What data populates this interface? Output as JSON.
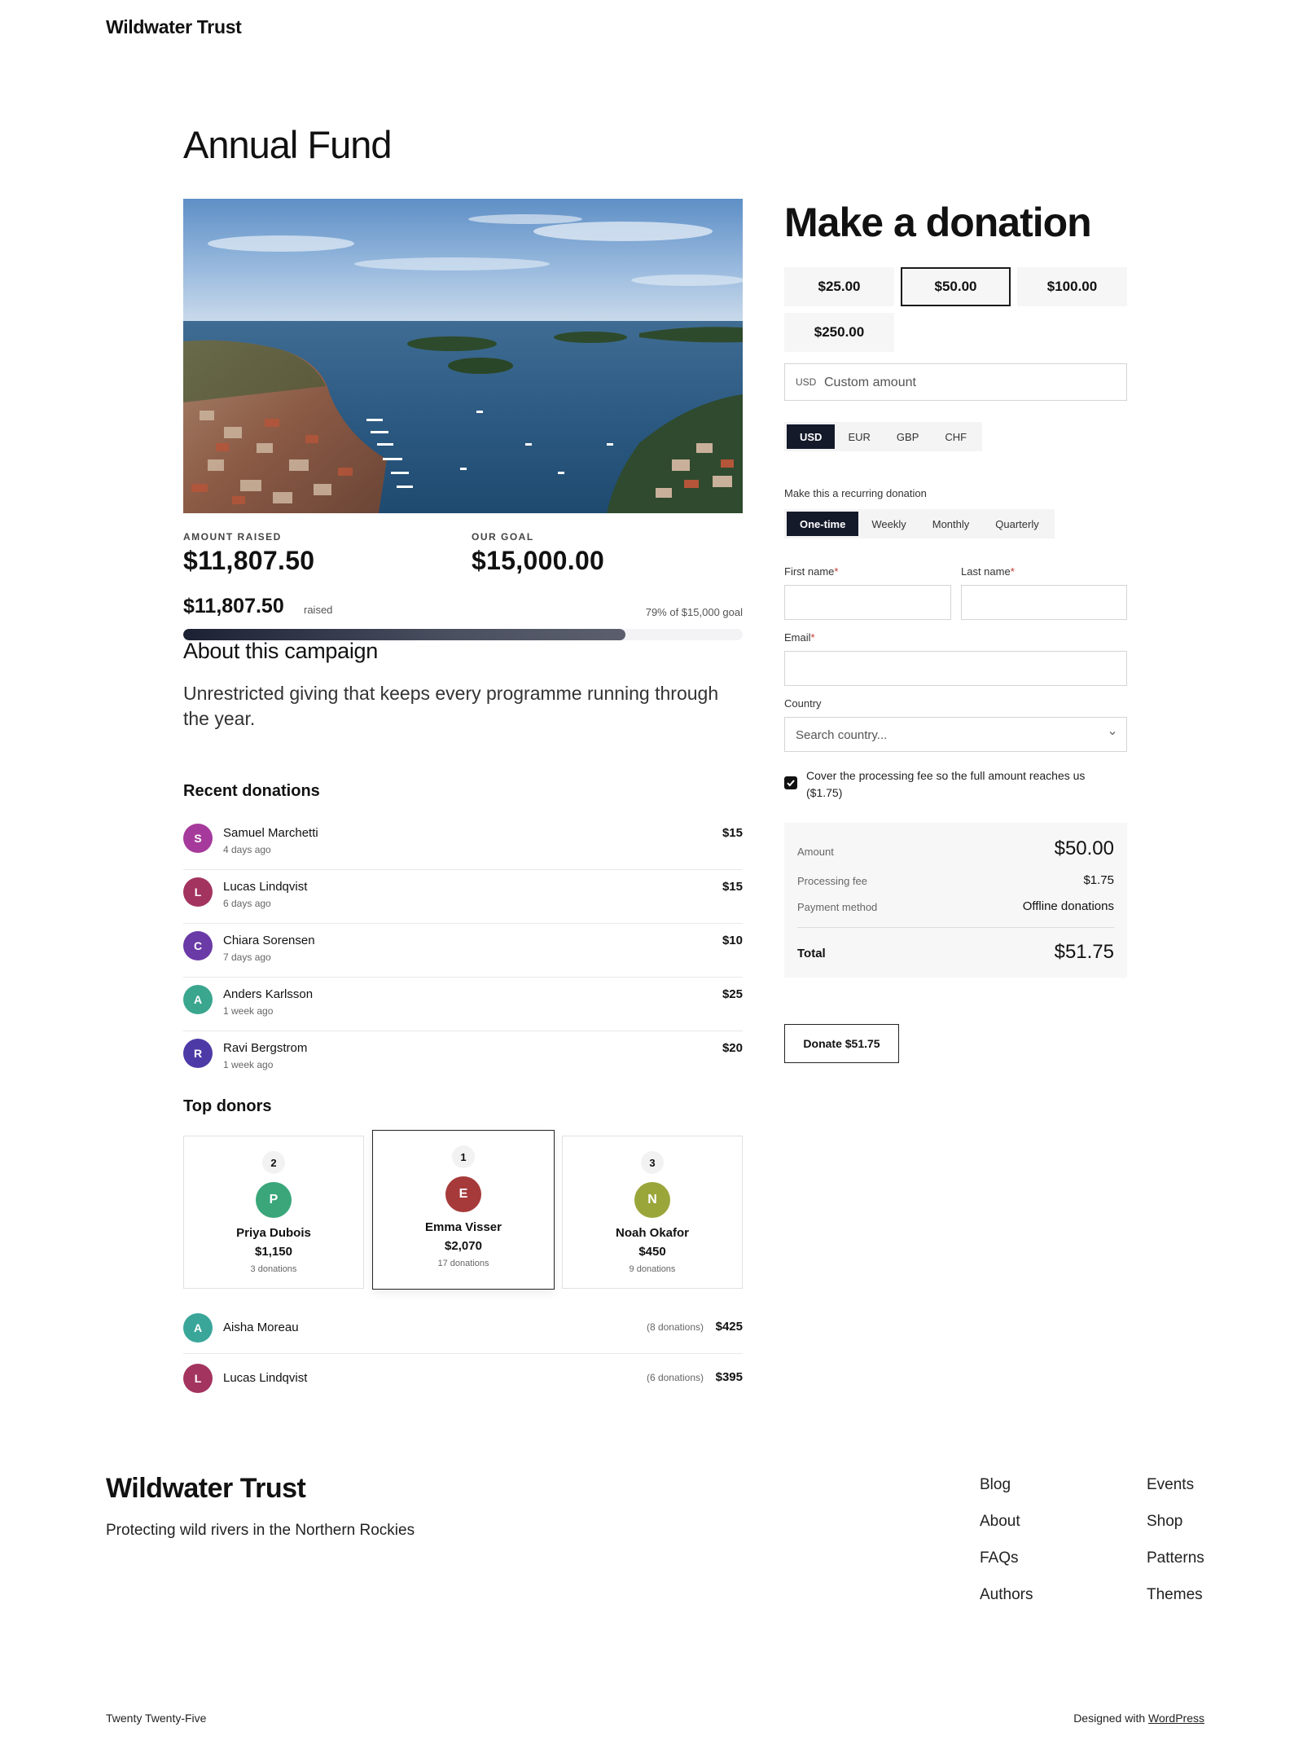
{
  "site": {
    "title": "Wildwater Trust"
  },
  "page": {
    "title": "Annual Fund"
  },
  "stats": {
    "raised_label": "AMOUNT RAISED",
    "raised_value": "$11,807.50",
    "goal_label": "OUR GOAL",
    "goal_value": "$15,000.00"
  },
  "progress": {
    "raised_amount": "$11,807.50",
    "raised_word": "raised",
    "goal_text": "79% of $15,000 goal",
    "percent": 79
  },
  "about": {
    "heading": "About this campaign",
    "text": "Unrestricted giving that keeps every programme running through the year."
  },
  "recent": {
    "heading": "Recent donations",
    "items": [
      {
        "initial": "S",
        "name": "Samuel Marchetti",
        "time": "4 days ago",
        "amount": "$15",
        "color": "#a63a9c"
      },
      {
        "initial": "L",
        "name": "Lucas Lindqvist",
        "time": "6 days ago",
        "amount": "$15",
        "color": "#a3345f"
      },
      {
        "initial": "C",
        "name": "Chiara Sorensen",
        "time": "7 days ago",
        "amount": "$10",
        "color": "#6a3aa6"
      },
      {
        "initial": "A",
        "name": "Anders Karlsson",
        "time": "1 week ago",
        "amount": "$25",
        "color": "#3aa68e"
      },
      {
        "initial": "R",
        "name": "Ravi Bergstrom",
        "time": "1 week ago",
        "amount": "$20",
        "color": "#4e3aa6"
      }
    ]
  },
  "top": {
    "heading": "Top donors",
    "podium": [
      {
        "rank": "2",
        "initial": "P",
        "name": "Priya Dubois",
        "total": "$1,150",
        "count": "3 donations",
        "color": "#3aa67a"
      },
      {
        "rank": "1",
        "initial": "E",
        "name": "Emma Visser",
        "total": "$2,070",
        "count": "17 donations",
        "color": "#a63a3a"
      },
      {
        "rank": "3",
        "initial": "N",
        "name": "Noah Okafor",
        "total": "$450",
        "count": "9 donations",
        "color": "#9aa63a"
      }
    ],
    "others": [
      {
        "initial": "A",
        "name": "Aisha Moreau",
        "count": "(8 donations)",
        "amount": "$425",
        "color": "#3aa69a"
      },
      {
        "initial": "L",
        "name": "Lucas Lindqvist",
        "count": "(6 donations)",
        "amount": "$395",
        "color": "#a3345f"
      }
    ]
  },
  "donation": {
    "title": "Make a donation",
    "amounts": [
      "$25.00",
      "$50.00",
      "$100.00",
      "$250.00"
    ],
    "selected_amount": "$50.00",
    "custom_prefix": "USD",
    "custom_placeholder": "Custom amount",
    "currencies": [
      "USD",
      "EUR",
      "GBP",
      "CHF"
    ],
    "selected_currency": "USD",
    "recurring_label": "Make this a recurring donation",
    "frequencies": [
      "One-time",
      "Weekly",
      "Monthly",
      "Quarterly"
    ],
    "selected_frequency": "One-time",
    "first_name_label": "First name",
    "last_name_label": "Last name",
    "email_label": "Email",
    "required_mark": "*",
    "country_label": "Country",
    "country_placeholder": "Search country...",
    "fee_checked": true,
    "fee_text": "Cover the processing fee so the full amount reaches us ($1.75)",
    "summary": {
      "amount_label": "Amount",
      "amount_value": "$50.00",
      "fee_label": "Processing fee",
      "fee_value": "$1.75",
      "method_label": "Payment method",
      "method_value": "Offline donations",
      "total_label": "Total",
      "total_value": "$51.75"
    },
    "donate_button": "Donate $51.75"
  },
  "footer": {
    "title": "Wildwater Trust",
    "tagline": "Protecting wild rivers in the Northern Rockies",
    "links_col1": [
      "Blog",
      "About",
      "FAQs",
      "Authors"
    ],
    "links_col2": [
      "Events",
      "Shop",
      "Patterns",
      "Themes"
    ],
    "theme": "Twenty Twenty-Five",
    "designed_with": "Designed with",
    "wordpress": "WordPress"
  },
  "colors": {
    "accent_dark": "#141a2a",
    "progress_fill": "#2a2f40",
    "panel_bg": "#f7f7f8"
  }
}
